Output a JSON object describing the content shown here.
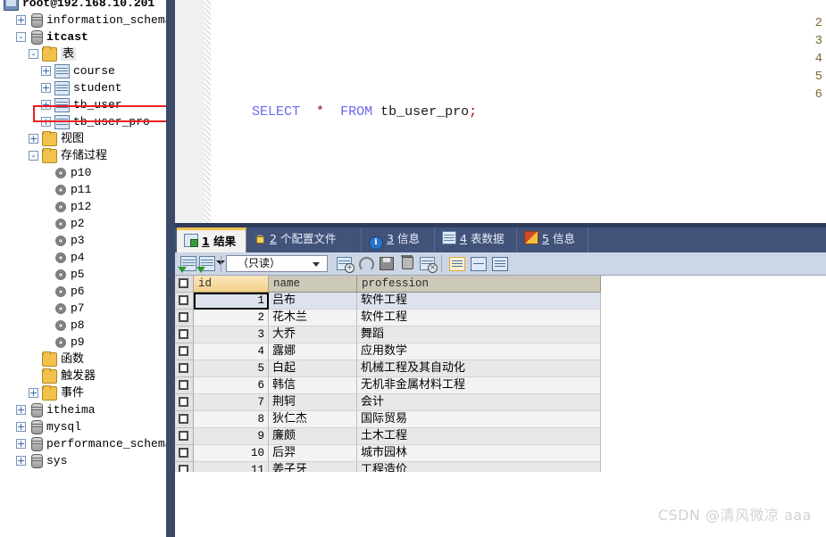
{
  "colors": {
    "panel_tab_bg": "#42537a",
    "active_tab_accent": "#f0c050",
    "highlight_box": "#ee1d23",
    "toolbar_bg": "#cdd6e4",
    "divider": "#3a4a68",
    "sorted_col_header": "#f3d08a"
  },
  "sidebar": {
    "connection": {
      "label": "root@192.168.10.201",
      "icon": "monitor-icon"
    },
    "items": [
      {
        "label": "information_schema",
        "icon": "database-icon",
        "indent": 1,
        "expander": "+",
        "kind": "db"
      },
      {
        "label": "itcast",
        "icon": "database-icon",
        "indent": 1,
        "expander": "-",
        "kind": "db",
        "bold": true
      },
      {
        "label": "表",
        "icon": "folder-icon",
        "indent": 2,
        "expander": "-",
        "kind": "folder",
        "selected": true
      },
      {
        "label": "course",
        "icon": "table-icon",
        "indent": 3,
        "expander": "+",
        "kind": "table"
      },
      {
        "label": "student",
        "icon": "table-icon",
        "indent": 3,
        "expander": "+",
        "kind": "table"
      },
      {
        "label": "tb_user",
        "icon": "table-icon",
        "indent": 3,
        "expander": "+",
        "kind": "table"
      },
      {
        "label": "tb_user_pro",
        "icon": "table-icon",
        "indent": 3,
        "expander": "+",
        "kind": "table",
        "highlighted": true
      },
      {
        "label": "视图",
        "icon": "folder-icon",
        "indent": 2,
        "expander": "+",
        "kind": "folder"
      },
      {
        "label": "存储过程",
        "icon": "folder-icon",
        "indent": 2,
        "expander": "-",
        "kind": "folder"
      },
      {
        "label": "p10",
        "icon": "procedure-icon",
        "indent": 3,
        "expander": "",
        "kind": "proc"
      },
      {
        "label": "p11",
        "icon": "procedure-icon",
        "indent": 3,
        "expander": "",
        "kind": "proc"
      },
      {
        "label": "p12",
        "icon": "procedure-icon",
        "indent": 3,
        "expander": "",
        "kind": "proc"
      },
      {
        "label": "p2",
        "icon": "procedure-icon",
        "indent": 3,
        "expander": "",
        "kind": "proc"
      },
      {
        "label": "p3",
        "icon": "procedure-icon",
        "indent": 3,
        "expander": "",
        "kind": "proc"
      },
      {
        "label": "p4",
        "icon": "procedure-icon",
        "indent": 3,
        "expander": "",
        "kind": "proc"
      },
      {
        "label": "p5",
        "icon": "procedure-icon",
        "indent": 3,
        "expander": "",
        "kind": "proc"
      },
      {
        "label": "p6",
        "icon": "procedure-icon",
        "indent": 3,
        "expander": "",
        "kind": "proc"
      },
      {
        "label": "p7",
        "icon": "procedure-icon",
        "indent": 3,
        "expander": "",
        "kind": "proc"
      },
      {
        "label": "p8",
        "icon": "procedure-icon",
        "indent": 3,
        "expander": "",
        "kind": "proc"
      },
      {
        "label": "p9",
        "icon": "procedure-icon",
        "indent": 3,
        "expander": "",
        "kind": "proc"
      },
      {
        "label": "函数",
        "icon": "folder-icon",
        "indent": 2,
        "expander": "",
        "kind": "folder"
      },
      {
        "label": "触发器",
        "icon": "folder-icon",
        "indent": 2,
        "expander": "",
        "kind": "folder"
      },
      {
        "label": "事件",
        "icon": "folder-icon",
        "indent": 2,
        "expander": "+",
        "kind": "folder"
      },
      {
        "label": "itheima",
        "icon": "database-icon",
        "indent": 1,
        "expander": "+",
        "kind": "db"
      },
      {
        "label": "mysql",
        "icon": "database-icon",
        "indent": 1,
        "expander": "+",
        "kind": "db"
      },
      {
        "label": "performance_schema",
        "icon": "database-icon",
        "indent": 1,
        "expander": "+",
        "kind": "db"
      },
      {
        "label": "sys",
        "icon": "database-icon",
        "indent": 1,
        "expander": "+",
        "kind": "db"
      }
    ]
  },
  "editor": {
    "line_numbers": [
      "2",
      "3",
      "4",
      "5",
      "6"
    ],
    "code": {
      "keyword1": "SELECT",
      "star": "*",
      "keyword2": "FROM",
      "identifier": "tb_user_pro",
      "terminator": ";"
    }
  },
  "panel": {
    "tabs": [
      {
        "num": "1",
        "label": "结果",
        "icon": "result-grid-icon",
        "active": true
      },
      {
        "num": "2",
        "label": "个配置文件",
        "icon": "profile-icon",
        "active": false
      },
      {
        "num": "3",
        "label": "信息",
        "icon": "info-icon",
        "active": false
      },
      {
        "num": "4",
        "label": "表数据",
        "icon": "table-data-icon",
        "active": false
      },
      {
        "num": "5",
        "label": "信息",
        "icon": "status-info-icon",
        "active": false
      }
    ],
    "toolbar": {
      "mode_value": "（只读）",
      "buttons": [
        "apply-changes-icon",
        "apply-all-icon",
        "dropdown-caret-icon",
        "insert-row-icon",
        "refresh-icon",
        "save-icon",
        "delete-row-icon",
        "discard-changes-icon",
        "grid-view-icon",
        "form-view-icon",
        "text-view-icon"
      ]
    },
    "grid": {
      "columns": [
        "id",
        "name",
        "profession"
      ],
      "sorted_column": "id",
      "rows": [
        {
          "id": "1",
          "name": "吕布",
          "profession": "软件工程"
        },
        {
          "id": "2",
          "name": "花木兰",
          "profession": "软件工程"
        },
        {
          "id": "3",
          "name": "大乔",
          "profession": "舞蹈"
        },
        {
          "id": "4",
          "name": "露娜",
          "profession": "应用数学"
        },
        {
          "id": "5",
          "name": "白起",
          "profession": "机械工程及其自动化"
        },
        {
          "id": "6",
          "name": "韩信",
          "profession": "无机非金属材料工程"
        },
        {
          "id": "7",
          "name": "荆轲",
          "profession": "会计"
        },
        {
          "id": "8",
          "name": "狄仁杰",
          "profession": "国际贸易"
        },
        {
          "id": "9",
          "name": "廉颇",
          "profession": "土木工程"
        },
        {
          "id": "10",
          "name": "后羿",
          "profession": "城市园林"
        },
        {
          "id": "11",
          "name": "姜子牙",
          "profession": "工程造价"
        }
      ]
    }
  },
  "watermark": {
    "text": "CSDN @清风微凉 aaa"
  }
}
